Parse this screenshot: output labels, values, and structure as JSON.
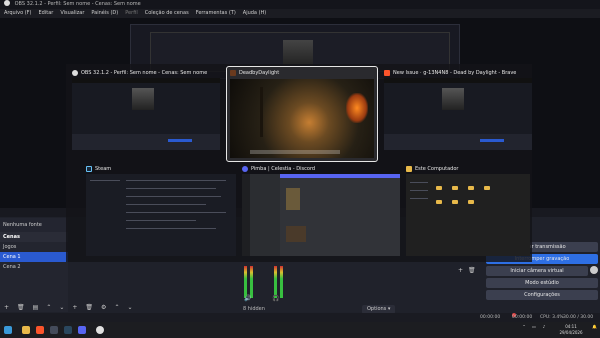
{
  "obs": {
    "title": "OBS 32.1.2 - Perfil: Sem nome - Cenas: Sem nome",
    "menu": [
      "Arquivo (F)",
      "Editar",
      "Visualizar",
      "Painéis (D)",
      "Perfil",
      "Coleção de cenas",
      "Ferramentas (T)",
      "Ajuda (H)"
    ],
    "no_source": "Nenhuma fonte selecionada",
    "scenes_title": "Cenas",
    "scenes": [
      "Jogos",
      "Cena 1",
      "Cena 2"
    ],
    "active_scene_index": 1,
    "hidden_count": "8 hidden",
    "options_label": "Options",
    "controls": [
      "Iniciar transmissão",
      "Interromper gravação",
      "Iniciar câmera virtual",
      "Modo estúdio",
      "Configurações"
    ],
    "status": {
      "stream_time": "00:00:00",
      "rec_time": "00:00:00",
      "cpu": "CPU: 3.4%",
      "fps": "30.00 / 30.00 FPS"
    }
  },
  "switcher": {
    "windows": [
      {
        "title": "OBS 32.1.2 - Perfil: Sem nome - Cenas: Sem nome",
        "icon": "obs-icon",
        "color": "#dddddd"
      },
      {
        "title": "DeadbyDaylight",
        "icon": "game-icon",
        "color": "#6a3a1e"
      },
      {
        "title": "New Issue · g-13N4N8 - Dead by Daylight - Brave",
        "icon": "brave-icon",
        "color": "#fb542b"
      },
      {
        "title": "Steam",
        "icon": "steam-icon",
        "color": "#1b2838"
      },
      {
        "title": "Pimba | Celestia - Discord",
        "icon": "discord-icon",
        "color": "#5865f2"
      },
      {
        "title": "Este Computador",
        "icon": "folder-icon",
        "color": "#e8b94a"
      }
    ]
  },
  "taskbar": {
    "icons": [
      {
        "name": "windows-start-icon",
        "color": "#3a9ad9"
      },
      {
        "name": "file-explorer-icon",
        "color": "#e8b94a"
      },
      {
        "name": "brave-icon",
        "color": "#fb542b"
      },
      {
        "name": "terminal-icon",
        "color": "#444b5a"
      },
      {
        "name": "steam-icon",
        "color": "#2a475e"
      },
      {
        "name": "discord-icon",
        "color": "#5865f2"
      },
      {
        "name": "obs-icon",
        "color": "#e0e0e0"
      }
    ],
    "time": "04:11",
    "date": "29/04/2026"
  }
}
